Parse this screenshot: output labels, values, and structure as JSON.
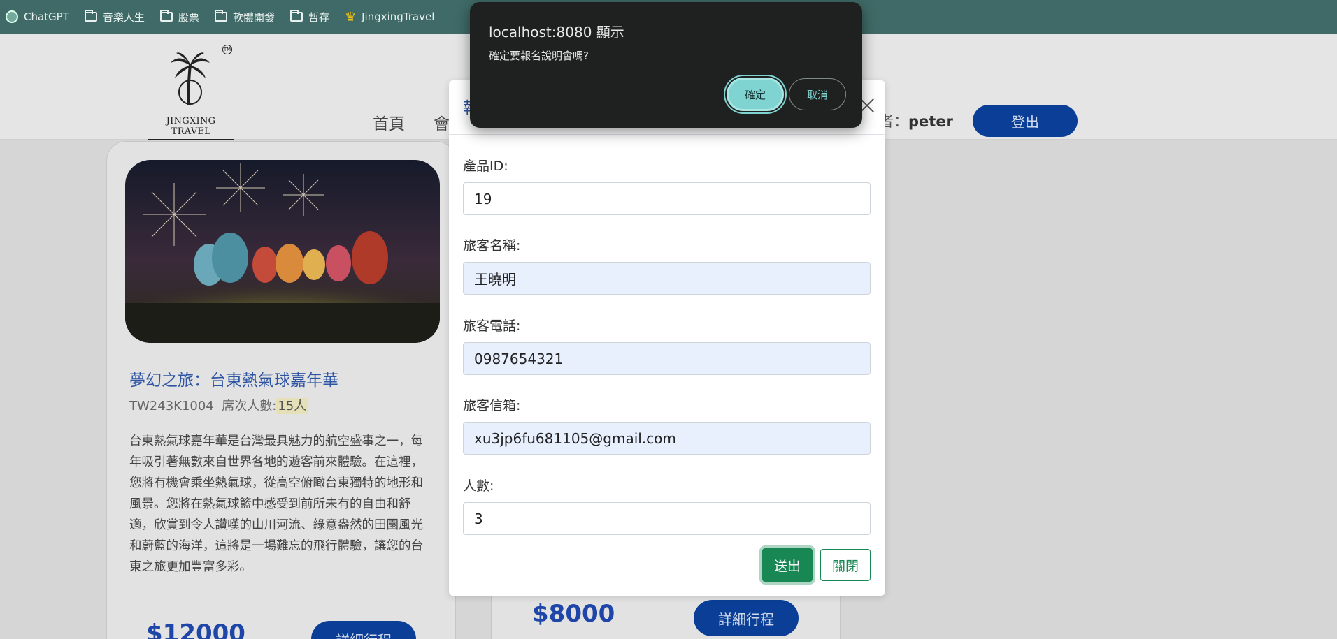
{
  "bookmarks": [
    {
      "label": "ChatGPT",
      "icon": "chatgpt-icon"
    },
    {
      "label": "音樂人生",
      "icon": "folder-icon"
    },
    {
      "label": "股票",
      "icon": "folder-icon"
    },
    {
      "label": "軟體開發",
      "icon": "folder-icon"
    },
    {
      "label": "暫存",
      "icon": "folder-icon"
    },
    {
      "label": "JingxingTravel",
      "icon": "crown-icon"
    }
  ],
  "header": {
    "logo_text": "JINGXING TRAVEL",
    "logo_tm": "TM",
    "nav_home": "首頁",
    "nav_member_partial": "會員",
    "user_label_partial": "用者：",
    "user_name": "peter",
    "logout_label": "登出"
  },
  "cards": [
    {
      "title": "夢幻之旅：台東熱氣球嘉年華",
      "code": "TW243K1004",
      "seats_label": "席次人數:",
      "seats_value": "15人",
      "description": "台東熱氣球嘉年華是台灣最具魅力的航空盛事之一，每年吸引著無數來自世界各地的遊客前來體驗。在這裡，您將有機會乘坐熱氣球，從高空俯瞰台東獨特的地形和風景。您將在熱氣球籃中感受到前所未有的自由和舒適，欣賞到令人讚嘆的山川河流、綠意盎然的田園風光和蔚藍的海洋，這將是一場難忘的飛行體驗，讓您的台東之旅更加豐富多彩。",
      "price": "$12000",
      "detail_label": "詳細行程"
    },
    {
      "price": "$8000",
      "detail_label": "詳細行程"
    }
  ],
  "modal": {
    "title_partial": "報",
    "fields": [
      {
        "label": "產品ID:",
        "value": "19"
      },
      {
        "label": "旅客名稱:",
        "value": "王曉明"
      },
      {
        "label": "旅客電話:",
        "value": "0987654321"
      },
      {
        "label": "旅客信箱:",
        "value": "xu3jp6fu681105@gmail.com"
      },
      {
        "label": "人數:",
        "value": "3"
      }
    ],
    "submit_label": "送出",
    "close_label": "關閉"
  },
  "alert": {
    "title": "localhost:8080 顯示",
    "message": "確定要報名說明會嗎?",
    "ok_label": "確定",
    "cancel_label": "取消"
  },
  "colors": {
    "bookmark_bar": "#3f6a67",
    "primary_blue": "#0b3f97",
    "title_blue": "#2e55a4",
    "success_green": "#198754",
    "alert_bg": "#1f2121",
    "alert_accent": "#7fd3d0",
    "autofill_bg": "#e8f0fe"
  }
}
